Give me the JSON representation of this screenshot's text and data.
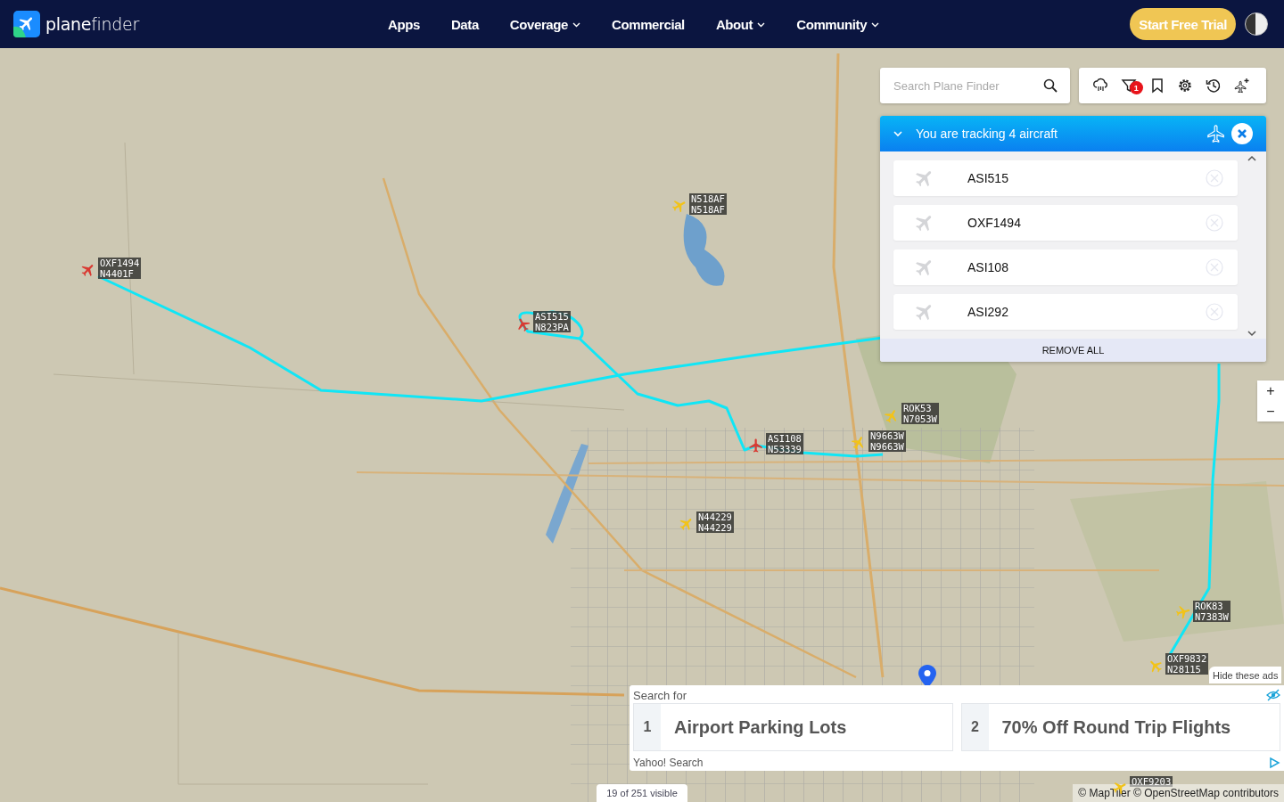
{
  "header": {
    "logo": "**plane**finder",
    "nav": [
      {
        "label": "Apps",
        "dropdown": false
      },
      {
        "label": "Data",
        "dropdown": false
      },
      {
        "label": "Coverage",
        "dropdown": true
      },
      {
        "label": "Commercial",
        "dropdown": false
      },
      {
        "label": "About",
        "dropdown": true
      },
      {
        "label": "Community",
        "dropdown": true
      }
    ],
    "cta": "Start Free Trial"
  },
  "search": {
    "placeholder": "Search Plane Finder"
  },
  "toolbar": [
    {
      "kind": "cloud"
    },
    {
      "kind": "filter",
      "badge": "1"
    },
    {
      "kind": "bookmark"
    },
    {
      "kind": "settings"
    },
    {
      "kind": "history"
    },
    {
      "kind": "plane-add"
    }
  ],
  "tracking": {
    "title": "You are tracking 4 aircraft",
    "expanded": true,
    "items": [
      "ASI515",
      "OXF1494",
      "ASI108",
      "ASI292"
    ],
    "remove_all": "REMOVE ALL"
  },
  "aircraft": [
    {
      "callsign": "OXF1494",
      "registration": "N4401F",
      "color": "#d93a32"
    },
    {
      "callsign": "N518AF",
      "registration": "N518AF",
      "color": "#f2c318"
    },
    {
      "callsign": "ASI515",
      "registration": "N823PA",
      "color": "#d93a32"
    },
    {
      "callsign": "ROK53",
      "registration": "N7053W",
      "color": "#f2c318"
    },
    {
      "callsign": "ASI108",
      "registration": "N53339",
      "color": "#d93a32"
    },
    {
      "callsign": "N9663W",
      "registration": "N9663W",
      "color": "#f2c318"
    },
    {
      "callsign": "N44229",
      "registration": "N44229",
      "color": "#f2c318"
    },
    {
      "callsign": "ROK83",
      "registration": "N7383W",
      "color": "#f2c318"
    },
    {
      "callsign": "OXF9832",
      "registration": "N28115",
      "color": "#f2c318"
    },
    {
      "callsign": "OXF9203",
      "color": "#f2c318"
    }
  ],
  "zoom_controls": [
    "+",
    "−"
  ],
  "ad": {
    "hide": "Hide these ads",
    "heading": "Search for",
    "results": [
      {
        "number": "1",
        "text": "Airport Parking Lots"
      },
      {
        "number": "2",
        "text": "70% Off Round Trip Flights"
      }
    ],
    "source": "Yahoo! Search"
  },
  "visible_count": "19 of 251 visible",
  "attribution": "© MapTiler © OpenStreetMap contributors"
}
